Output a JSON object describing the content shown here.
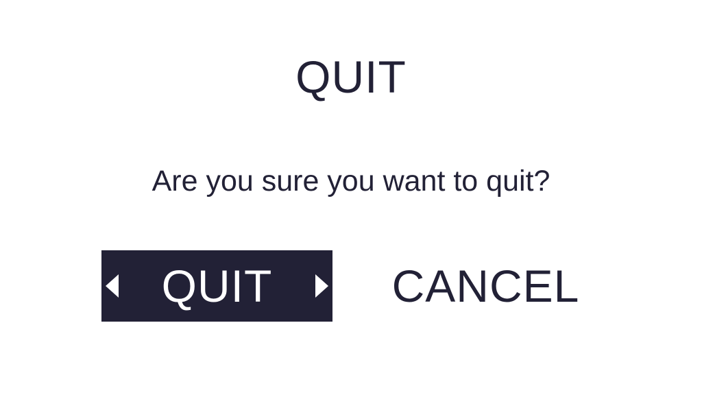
{
  "dialog": {
    "title": "QUIT",
    "message": "Are you sure you want to quit?",
    "buttons": {
      "quit_label": "QUIT",
      "cancel_label": "CANCEL"
    }
  },
  "icons": {
    "selector_left": "caret-left-icon",
    "selector_right": "caret-right-icon"
  },
  "colors": {
    "background": "#ffffff",
    "text": "#222136",
    "selected_button_bg": "#222136",
    "selected_button_text": "#ffffff"
  }
}
